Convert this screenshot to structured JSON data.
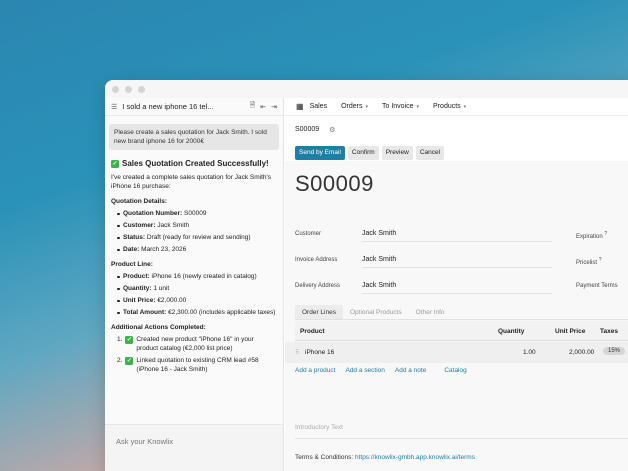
{
  "chat": {
    "title": "I sold a new iphone 16 tel...",
    "user_message": "Please create a sales quotation for Jack Smith. I sold new brand iphone 16 for 2000€",
    "reply_heading": "Sales Quotation Created Successfully!",
    "reply_intro": "I've created a complete sales quotation for Jack Smith's iPhone 16 purchase:",
    "quotation_details_label": "Quotation Details:",
    "quotation_details": [
      {
        "key": "Quotation Number:",
        "value": " S00009"
      },
      {
        "key": "Customer:",
        "value": " Jack Smith"
      },
      {
        "key": "Status:",
        "value": " Draft (ready for review and sending)"
      },
      {
        "key": "Date:",
        "value": " March 23, 2026"
      }
    ],
    "product_line_label": "Product Line:",
    "product_line": [
      {
        "key": "Product:",
        "value": " iPhone 16 (newly created in catalog)"
      },
      {
        "key": "Quantity:",
        "value": " 1 unit"
      },
      {
        "key": "Unit Price:",
        "value": " €2,000.00"
      },
      {
        "key": "Total Amount:",
        "value": " €2,300.00 (includes applicable taxes)"
      }
    ],
    "additional_label": "Additional Actions Completed:",
    "additional_actions": [
      {
        "num": "1.",
        "text": "Created new product \"iPhone 16\" in your product catalog (€2,000 list price)"
      },
      {
        "num": "2.",
        "text": "Linked quotation to existing CRM lead #58 (iPhone 16 - Jack Smith)"
      }
    ],
    "input_placeholder": "Ask your Knowlix",
    "plus_label": "+"
  },
  "odoo": {
    "nav": {
      "app": "Sales",
      "orders": "Orders",
      "to_invoice": "To Invoice",
      "products": "Products"
    },
    "breadcrumb": "S00009",
    "buttons": {
      "send_email": "Send by Email",
      "confirm": "Confirm",
      "preview": "Preview",
      "cancel": "Cancel"
    },
    "doc_title": "S00009",
    "fields": {
      "customer_label": "Customer",
      "customer": "Jack Smith",
      "invoice_label": "Invoice Address",
      "invoice": "Jack Smith",
      "delivery_label": "Delivery Address",
      "delivery": "Jack Smith",
      "expiration_label": "Expiration",
      "pricelist_label": "Pricelist",
      "payment_label": "Payment Terms"
    },
    "tabs": [
      "Order Lines",
      "Optional Products",
      "Other Info"
    ],
    "columns": {
      "product": "Product",
      "quantity": "Quantity",
      "unit_price": "Unit Price",
      "taxes": "Taxes"
    },
    "line": {
      "product": "iPhone 16",
      "quantity": "1.00",
      "unit_price": "2,000.00",
      "tax": "15%"
    },
    "links": {
      "add_product": "Add a product",
      "add_section": "Add a section",
      "add_note": "Add a note",
      "catalog": "Catalog"
    },
    "intro_placeholder": "Introductory Text",
    "terms_label": "Terms & Conditions: ",
    "terms_link": "https://knowlix-gmbh.app.knowlix.ai/terms"
  },
  "colors": {
    "accent": "#1e7fa6",
    "success": "#3bb54a"
  }
}
